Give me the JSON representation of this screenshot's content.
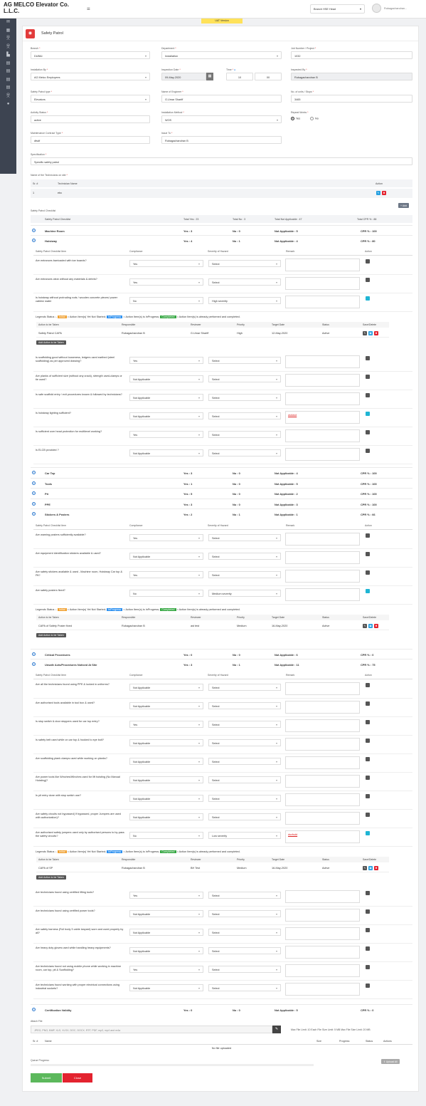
{
  "app": {
    "brand": "AG MELCO Elevator Co. L.L.C.",
    "branch": "Branch HSE Head",
    "user": "Rubagachandran...",
    "env": "UAT Version"
  },
  "sidebar": [
    "envelope-icon",
    "grid-icon",
    "person-icon",
    "person-icon",
    "chart-icon",
    "file-icon",
    "file-icon",
    "file-icon",
    "file-icon",
    "person-icon",
    "comment-icon"
  ],
  "page": {
    "title": "Safety Patrol"
  },
  "form": {
    "branch": {
      "label": "Branch",
      "value": "DUBAI"
    },
    "department": {
      "label": "Department",
      "value": "Installation"
    },
    "job": {
      "label": "Job Number / Project",
      "value": "1032"
    },
    "installation_by": {
      "label": "Installation By",
      "value": "AG Melco Employees"
    },
    "inspection_date": {
      "label": "Inspection Date",
      "value": "09-May-2020"
    },
    "time": {
      "label": "Time",
      "hour": "10",
      "min": "00"
    },
    "inspected_by": {
      "label": "Inspected By",
      "value": "Rubagachandran B"
    },
    "patrol_type": {
      "label": "Safety Patrol type",
      "value": "Elevators"
    },
    "engineer": {
      "label": "Name of Engineer",
      "value": "G.Umar Shariff"
    },
    "units": {
      "label": "No. of units / Stops",
      "value": "3465"
    },
    "activity": {
      "label": "Activity Status",
      "value": "active"
    },
    "method": {
      "label": "Installation Method",
      "value": "WOS"
    },
    "repeat": {
      "label": "Repeat Works",
      "yes": "Yes",
      "no": "No"
    },
    "contract": {
      "label": "Maintenance Contract Type",
      "value": "dfsdf"
    },
    "issue_to": {
      "label": "Issue To",
      "value": "Rubagachandran B"
    },
    "spec": {
      "label": "Specification",
      "value": "Specific safety patrol"
    }
  },
  "tech": {
    "label": "Name of the Technicians on site",
    "h_sr": "Sr. #",
    "h_name": "Technician Name",
    "h_action": "Action",
    "rows": [
      {
        "sr": "1",
        "name": "ebc"
      }
    ],
    "add": "Add"
  },
  "checklist": {
    "label": "Safety Patrol Checklist",
    "header": {
      "name": "Safety Patrol Checklist",
      "yes": "Total Yes : 23",
      "no": "Total No : 3",
      "na": "Total Not Applicable : 47",
      "cpr": "Total CPR % : 88"
    },
    "cols": {
      "item": "Safety Patrol Checklist Item",
      "comp": "Compliance",
      "sev": "Severity of Hazard",
      "rem": "Remark",
      "act": "Action"
    },
    "cats": [
      {
        "name": "Machine Room",
        "yes": "Yes : 3",
        "no": "No : 0",
        "na": "Not Applicable : 5",
        "cpr": "CPR % : 100"
      },
      {
        "name": "Hoistway",
        "yes": "Yes : 4",
        "no": "No : 1",
        "na": "Not Applicable : 4",
        "cpr": "CPR % : 80"
      },
      {
        "name": "Car Top",
        "yes": "Yes : 3",
        "no": "No : 0",
        "na": "Not Applicable : 4",
        "cpr": "CPR % : 100"
      },
      {
        "name": "Tools",
        "yes": "Yes : 1",
        "no": "No : 0",
        "na": "Not Applicable : 5",
        "cpr": "CPR % : 100"
      },
      {
        "name": "Pit",
        "yes": "Yes : 5",
        "no": "No : 0",
        "na": "Not Applicable : 2",
        "cpr": "CPR % : 100"
      },
      {
        "name": "PPE",
        "yes": "Yes : 3",
        "no": "No : 0",
        "na": "Not Applicable : 3",
        "cpr": "CPR % : 100"
      },
      {
        "name": "Stickers & Posters",
        "yes": "Yes : 2",
        "no": "No : 1",
        "na": "Not Applicable : 1",
        "cpr": "CPR % : 66"
      },
      {
        "name": "Critical Procedures",
        "yes": "Yes : 0",
        "no": "No : 0",
        "na": "Not Applicable : 6",
        "cpr": "CPR % : 0"
      },
      {
        "name": "Unsafe Acts/Procedures Noticed At Site",
        "yes": "Yes : 3",
        "no": "No : 1",
        "na": "Not Applicable : 11",
        "cpr": "CPR % : 75"
      },
      {
        "name": "Certification Validity",
        "yes": "Yes : 0",
        "no": "No : 0",
        "na": "Not Applicable : 5",
        "cpr": "CPR % : 0"
      }
    ],
    "hoistway": [
      {
        "q": "Are entrances barricaded with toe boards?",
        "c": "Yes",
        "s": "Select",
        "r": ""
      },
      {
        "q": "Are entrances clear without any materials & debris?",
        "c": "Yes",
        "s": "Select",
        "r": ""
      },
      {
        "q": "Is hoistway without protruding rods / wooden concrete pieces/ power cables/ water",
        "c": "No",
        "s": "High severity",
        "r": ""
      },
      {
        "q": "Is scaffolding good without looseness, ledgers used earthed (steel scaffolding) as per approved drawing?",
        "c": "Yes",
        "s": "Select",
        "r": ""
      },
      {
        "q": "Are planks of sufficient size (without any crack), strength used-clamps or tie used?",
        "c": "Not Applicable",
        "s": "Select",
        "r": ""
      },
      {
        "q": "Is safe scaffold entry / exit procedures known & followed by technicians?",
        "c": "Not Applicable",
        "s": "Select",
        "r": ""
      },
      {
        "q": "Is hoistway lighting sufficient?",
        "c": "Not Applicable",
        "s": "Select",
        "r": "asdasd"
      },
      {
        "q": "Is sufficient over head protection for multilevel working?",
        "c": "Yes",
        "s": "Select",
        "r": ""
      },
      {
        "q": "Is ELCB provided ?",
        "c": "Not Applicable",
        "s": "Select",
        "r": ""
      }
    ],
    "stickers": [
      {
        "q": "Are warning posters sufficiently available?",
        "c": "Yes",
        "s": "Select"
      },
      {
        "q": "Are equipment identification stickers available & used?",
        "c": "Not Applicable",
        "s": "Select"
      },
      {
        "q": "Are safety stickers available & used - Machine room, Hoistway Car top & Pit?",
        "c": "Yes",
        "s": "Select"
      },
      {
        "q": "Are safety posters fixed?",
        "c": "No",
        "s": "Medium severity"
      }
    ],
    "unsafe": [
      {
        "q": "Are all the technicians found using PPE & locked in uniforms?",
        "c": "Not Applicable",
        "s": "Select",
        "r": ""
      },
      {
        "q": "Are authorised tools available in tool box & used?",
        "c": "Not Applicable",
        "s": "Select",
        "r": ""
      },
      {
        "q": "Is stop switch & door stoppers used for car top entry?",
        "c": "Yes",
        "s": "Select",
        "r": ""
      },
      {
        "q": "Is safety belt used while on car top & hooked to eye bolt?",
        "c": "Not Applicable",
        "s": "Select",
        "r": ""
      },
      {
        "q": "Are scaffolding plank clamps used while working on planks?",
        "c": "Not Applicable",
        "s": "Select",
        "r": ""
      },
      {
        "q": "Are power tools like Winches/Winches used for lift hoisting (No Manual Hoisting)?",
        "c": "Not Applicable",
        "s": "Select",
        "r": ""
      },
      {
        "q": "Is pit entry done with stop switch use?",
        "c": "Not Applicable",
        "s": "Select",
        "r": ""
      },
      {
        "q": "Are safety circuits not bypassed( If bypassed, proper Jumpers are used with authorization)?",
        "c": "Not Applicable",
        "s": "Select",
        "r": ""
      },
      {
        "q": "Are authorised safety jumpers used only by authorised persons to by-pass the safety circuits?",
        "c": "No",
        "s": "Low severity",
        "r": "dsvfsdd"
      },
      {
        "q": "Are technicians found using certified lifting tools?",
        "c": "Yes",
        "s": "Select",
        "r": ""
      },
      {
        "q": "Are technicians found using certified power tools?",
        "c": "Not Applicable",
        "s": "Select",
        "r": ""
      },
      {
        "q": "Are safety harness (Full body 3 cable lanyard) worn and used properly by all?",
        "c": "Not Applicable",
        "s": "Select",
        "r": ""
      },
      {
        "q": "Are heavy duty gloves used while handling heavy equipments?",
        "c": "Not Applicable",
        "s": "Select",
        "r": ""
      },
      {
        "q": "Are technicians found not using mobile phone while working in machine room, car top, pit & Scaffolding?",
        "c": "Yes",
        "s": "Select",
        "r": ""
      },
      {
        "q": "Are technicians found working with proper electrical connections using industrial sockets?",
        "c": "Not Applicable",
        "s": "Select",
        "r": ""
      }
    ]
  },
  "legend": {
    "prefix": "Legends Status :-",
    "init": "Initial",
    "init_t": " = Action Item(s) Yet Not Started; ",
    "prog": "InProgress",
    "prog_t": " = Action Item(s) is InProgress; ",
    "comp": "Completed",
    "comp_t": " = Action Item(s) is already performed and completed."
  },
  "actions": {
    "h": {
      "a": "Action to be Taken",
      "r": "Responsible",
      "rv": "Reviewer",
      "p": "Priority",
      "d": "Target Date",
      "s": "Status",
      "sd": "Save/Delete"
    },
    "rows": [
      {
        "a": "Safety Patrol CAPA",
        "r": "Rubagachandran B",
        "rv": "G.Umar Shariff",
        "p": "High",
        "d": "12-May-2020",
        "s": "Active"
      },
      {
        "a": "CAPA of Safety Poster fixed",
        "r": "Rubagachandran B",
        "rv": "ast test",
        "p": "Medium",
        "d": "16-May-2020",
        "s": "Active"
      },
      {
        "a": "CAPA of SP",
        "r": "Rubagachandran B",
        "rv": "BH Test",
        "p": "Medium",
        "d": "16-May-2020",
        "s": "Active"
      }
    ],
    "add": "Add Action to be Taken"
  },
  "attach": {
    "label": "Attach File",
    "placeholder": "JPEG, PNG, BMP, XLS, XLSX, DOC, DOCX, RTF, PDF, mp3, mp4 and m4a",
    "limits": "Max File Limit: 10   Each File Size Limit: 5 MB   Max File Size Limit: 20 MB",
    "h_sr": "Sr. #",
    "h_name": "Name",
    "h_size": "Size",
    "h_prog": "Progress",
    "h_status": "Status",
    "h_act": "Actions",
    "empty": "No file uploaded",
    "queue": "Queue Progress:",
    "upload_all": "Upload All"
  },
  "buttons": {
    "submit": "Submit",
    "close": "Close"
  }
}
